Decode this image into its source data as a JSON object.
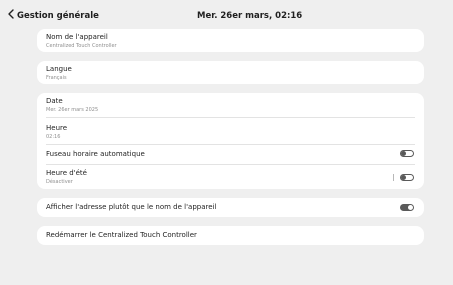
{
  "header": {
    "title": "Gestion générale",
    "datetime": "Mer. 26er mars, 02:16"
  },
  "device": {
    "label": "Nom de l'appareil",
    "value": "Centralized Touch Controller"
  },
  "language": {
    "label": "Langue",
    "value": "Français"
  },
  "datetime_card": {
    "date_label": "Date",
    "date_value": "Mer. 26er mars 2025",
    "time_label": "Heure",
    "time_value": "02:16",
    "auto_tz_label": "Fuseau horaire automatique",
    "auto_tz_on": false,
    "dst_label": "Heure d'été",
    "dst_value": "Désactiver",
    "dst_on": false
  },
  "show_address": {
    "label": "Afficher l'adresse plutôt que le nom de l'appareil",
    "on": true
  },
  "restart": {
    "label": "Redémarrer le Centralized Touch Controller"
  }
}
